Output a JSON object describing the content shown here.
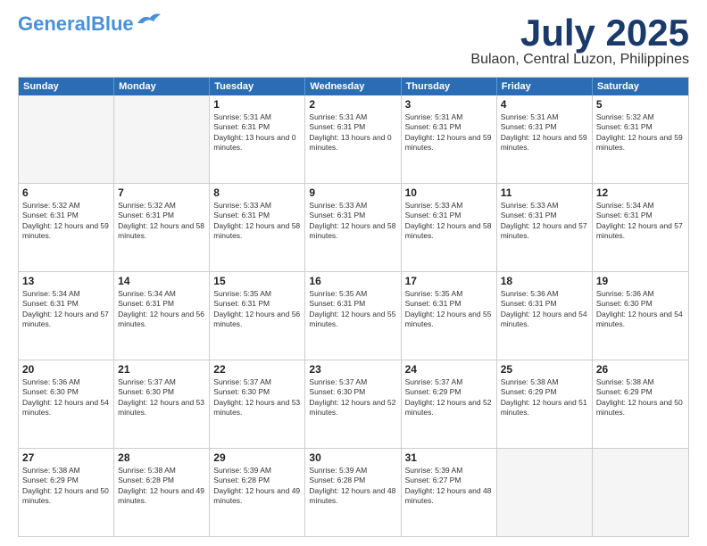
{
  "logo": {
    "line1": "General",
    "line2": "Blue"
  },
  "title": "July 2025",
  "subtitle": "Bulaon, Central Luzon, Philippines",
  "days": [
    "Sunday",
    "Monday",
    "Tuesday",
    "Wednesday",
    "Thursday",
    "Friday",
    "Saturday"
  ],
  "weeks": [
    [
      {
        "day": "",
        "empty": true
      },
      {
        "day": "",
        "empty": true
      },
      {
        "day": "1",
        "sunrise": "Sunrise: 5:31 AM",
        "sunset": "Sunset: 6:31 PM",
        "daylight": "Daylight: 13 hours and 0 minutes."
      },
      {
        "day": "2",
        "sunrise": "Sunrise: 5:31 AM",
        "sunset": "Sunset: 6:31 PM",
        "daylight": "Daylight: 13 hours and 0 minutes."
      },
      {
        "day": "3",
        "sunrise": "Sunrise: 5:31 AM",
        "sunset": "Sunset: 6:31 PM",
        "daylight": "Daylight: 12 hours and 59 minutes."
      },
      {
        "day": "4",
        "sunrise": "Sunrise: 5:31 AM",
        "sunset": "Sunset: 6:31 PM",
        "daylight": "Daylight: 12 hours and 59 minutes."
      },
      {
        "day": "5",
        "sunrise": "Sunrise: 5:32 AM",
        "sunset": "Sunset: 6:31 PM",
        "daylight": "Daylight: 12 hours and 59 minutes."
      }
    ],
    [
      {
        "day": "6",
        "sunrise": "Sunrise: 5:32 AM",
        "sunset": "Sunset: 6:31 PM",
        "daylight": "Daylight: 12 hours and 59 minutes."
      },
      {
        "day": "7",
        "sunrise": "Sunrise: 5:32 AM",
        "sunset": "Sunset: 6:31 PM",
        "daylight": "Daylight: 12 hours and 58 minutes."
      },
      {
        "day": "8",
        "sunrise": "Sunrise: 5:33 AM",
        "sunset": "Sunset: 6:31 PM",
        "daylight": "Daylight: 12 hours and 58 minutes."
      },
      {
        "day": "9",
        "sunrise": "Sunrise: 5:33 AM",
        "sunset": "Sunset: 6:31 PM",
        "daylight": "Daylight: 12 hours and 58 minutes."
      },
      {
        "day": "10",
        "sunrise": "Sunrise: 5:33 AM",
        "sunset": "Sunset: 6:31 PM",
        "daylight": "Daylight: 12 hours and 58 minutes."
      },
      {
        "day": "11",
        "sunrise": "Sunrise: 5:33 AM",
        "sunset": "Sunset: 6:31 PM",
        "daylight": "Daylight: 12 hours and 57 minutes."
      },
      {
        "day": "12",
        "sunrise": "Sunrise: 5:34 AM",
        "sunset": "Sunset: 6:31 PM",
        "daylight": "Daylight: 12 hours and 57 minutes."
      }
    ],
    [
      {
        "day": "13",
        "sunrise": "Sunrise: 5:34 AM",
        "sunset": "Sunset: 6:31 PM",
        "daylight": "Daylight: 12 hours and 57 minutes."
      },
      {
        "day": "14",
        "sunrise": "Sunrise: 5:34 AM",
        "sunset": "Sunset: 6:31 PM",
        "daylight": "Daylight: 12 hours and 56 minutes."
      },
      {
        "day": "15",
        "sunrise": "Sunrise: 5:35 AM",
        "sunset": "Sunset: 6:31 PM",
        "daylight": "Daylight: 12 hours and 56 minutes."
      },
      {
        "day": "16",
        "sunrise": "Sunrise: 5:35 AM",
        "sunset": "Sunset: 6:31 PM",
        "daylight": "Daylight: 12 hours and 55 minutes."
      },
      {
        "day": "17",
        "sunrise": "Sunrise: 5:35 AM",
        "sunset": "Sunset: 6:31 PM",
        "daylight": "Daylight: 12 hours and 55 minutes."
      },
      {
        "day": "18",
        "sunrise": "Sunrise: 5:36 AM",
        "sunset": "Sunset: 6:31 PM",
        "daylight": "Daylight: 12 hours and 54 minutes."
      },
      {
        "day": "19",
        "sunrise": "Sunrise: 5:36 AM",
        "sunset": "Sunset: 6:30 PM",
        "daylight": "Daylight: 12 hours and 54 minutes."
      }
    ],
    [
      {
        "day": "20",
        "sunrise": "Sunrise: 5:36 AM",
        "sunset": "Sunset: 6:30 PM",
        "daylight": "Daylight: 12 hours and 54 minutes."
      },
      {
        "day": "21",
        "sunrise": "Sunrise: 5:37 AM",
        "sunset": "Sunset: 6:30 PM",
        "daylight": "Daylight: 12 hours and 53 minutes."
      },
      {
        "day": "22",
        "sunrise": "Sunrise: 5:37 AM",
        "sunset": "Sunset: 6:30 PM",
        "daylight": "Daylight: 12 hours and 53 minutes."
      },
      {
        "day": "23",
        "sunrise": "Sunrise: 5:37 AM",
        "sunset": "Sunset: 6:30 PM",
        "daylight": "Daylight: 12 hours and 52 minutes."
      },
      {
        "day": "24",
        "sunrise": "Sunrise: 5:37 AM",
        "sunset": "Sunset: 6:29 PM",
        "daylight": "Daylight: 12 hours and 52 minutes."
      },
      {
        "day": "25",
        "sunrise": "Sunrise: 5:38 AM",
        "sunset": "Sunset: 6:29 PM",
        "daylight": "Daylight: 12 hours and 51 minutes."
      },
      {
        "day": "26",
        "sunrise": "Sunrise: 5:38 AM",
        "sunset": "Sunset: 6:29 PM",
        "daylight": "Daylight: 12 hours and 50 minutes."
      }
    ],
    [
      {
        "day": "27",
        "sunrise": "Sunrise: 5:38 AM",
        "sunset": "Sunset: 6:29 PM",
        "daylight": "Daylight: 12 hours and 50 minutes."
      },
      {
        "day": "28",
        "sunrise": "Sunrise: 5:38 AM",
        "sunset": "Sunset: 6:28 PM",
        "daylight": "Daylight: 12 hours and 49 minutes."
      },
      {
        "day": "29",
        "sunrise": "Sunrise: 5:39 AM",
        "sunset": "Sunset: 6:28 PM",
        "daylight": "Daylight: 12 hours and 49 minutes."
      },
      {
        "day": "30",
        "sunrise": "Sunrise: 5:39 AM",
        "sunset": "Sunset: 6:28 PM",
        "daylight": "Daylight: 12 hours and 48 minutes."
      },
      {
        "day": "31",
        "sunrise": "Sunrise: 5:39 AM",
        "sunset": "Sunset: 6:27 PM",
        "daylight": "Daylight: 12 hours and 48 minutes."
      },
      {
        "day": "",
        "empty": true
      },
      {
        "day": "",
        "empty": true
      }
    ]
  ]
}
